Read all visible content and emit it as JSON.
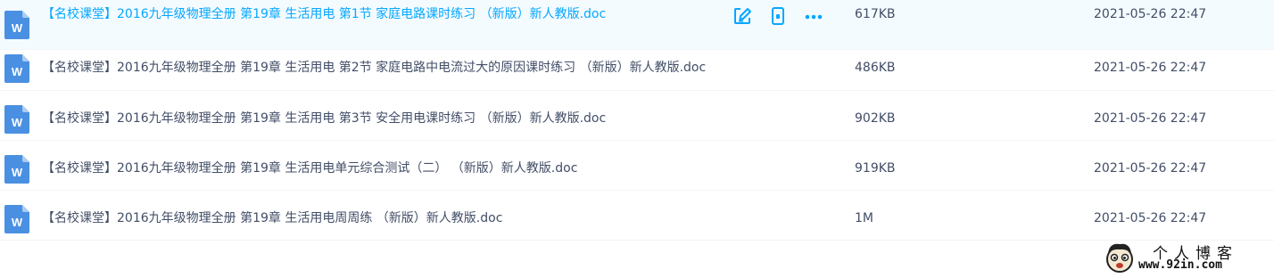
{
  "files": [
    {
      "name": "【名校课堂】2016九年级物理全册 第19章 生活用电 第1节 家庭电路课时练习 （新版）新人教版.doc",
      "size": "617KB",
      "date": "2021-05-26 22:47",
      "icon": "word-doc-icon"
    },
    {
      "name": "【名校课堂】2016九年级物理全册 第19章 生活用电 第2节 家庭电路中电流过大的原因课时练习 （新版）新人教版.doc",
      "size": "486KB",
      "date": "2021-05-26 22:47",
      "icon": "word-doc-icon"
    },
    {
      "name": "【名校课堂】2016九年级物理全册 第19章 生活用电 第3节 安全用电课时练习 （新版）新人教版.doc",
      "size": "902KB",
      "date": "2021-05-26 22:47",
      "icon": "word-doc-icon"
    },
    {
      "name": "【名校课堂】2016九年级物理全册 第19章 生活用电单元综合测试（二） （新版）新人教版.doc",
      "size": "919KB",
      "date": "2021-05-26 22:47",
      "icon": "word-doc-icon"
    },
    {
      "name": "【名校课堂】2016九年级物理全册 第19章 生活用电周周练 （新版）新人教版.doc",
      "size": "1M",
      "date": "2021-05-26 22:47",
      "icon": "word-doc-icon"
    }
  ],
  "row_actions": {
    "edit_icon": "edit-icon",
    "phone_icon": "phone-icon",
    "more_icon": "more-icon"
  },
  "watermark": {
    "title": "个人博客",
    "url": "www.92in.com"
  },
  "colors": {
    "accent": "#06a7ff",
    "text": "#424e67",
    "hover_bg": "#f4fbff",
    "word_blue": "#4a90e2"
  }
}
